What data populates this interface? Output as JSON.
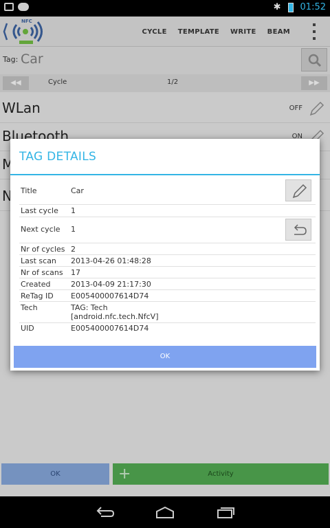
{
  "status_bar": {
    "time": "01:52"
  },
  "action_bar": {
    "logo_text": "NFC",
    "actions": [
      "CYCLE",
      "TEMPLATE",
      "WRITE",
      "BEAM"
    ]
  },
  "tag_row": {
    "label": "Tag:",
    "value": "Car"
  },
  "cycle_bar": {
    "label": "Cycle",
    "page": "1/2"
  },
  "background_items": [
    {
      "name": "WLan",
      "state": "OFF"
    },
    {
      "name": "Bluetooth",
      "state": "ON"
    },
    {
      "name": "M",
      "state": ""
    },
    {
      "name": "N",
      "state": ""
    }
  ],
  "bottom_buttons": {
    "ok": "OK",
    "activity": "Activity"
  },
  "dialog": {
    "title": "TAG DETAILS",
    "rows": [
      {
        "key": "Title",
        "value": "Car"
      },
      {
        "key": "Last cycle",
        "value": "1"
      },
      {
        "key": "Next cycle",
        "value": "1"
      },
      {
        "key": "Nr of cycles",
        "value": "2"
      },
      {
        "key": "Last scan",
        "value": "2013-04-26 01:48:28"
      },
      {
        "key": "Nr of scans",
        "value": "17"
      },
      {
        "key": "Created",
        "value": "2013-04-09 21:17:30"
      },
      {
        "key": "ReTag ID",
        "value": "E005400007614D74"
      },
      {
        "key": "Tech",
        "value": "TAG: Tech\n[android.nfc.tech.NfcV]"
      },
      {
        "key": "UID",
        "value": "E005400007614D74"
      }
    ],
    "ok_label": "OK"
  },
  "colors": {
    "accent": "#33b5e5",
    "ok_button": "#7fa3f0",
    "activity_button": "#4fa24f"
  }
}
